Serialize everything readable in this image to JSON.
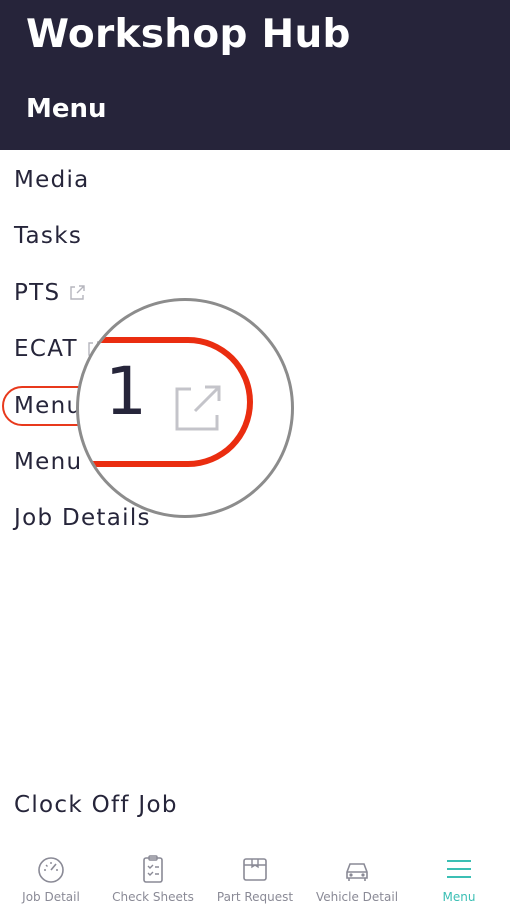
{
  "header": {
    "app_title": "Workshop Hub",
    "section_title": "Menu"
  },
  "menu": {
    "items": [
      {
        "label": "Media",
        "external": false
      },
      {
        "label": "Tasks",
        "external": false
      },
      {
        "label": "PTS",
        "external": true
      },
      {
        "label": "ECAT",
        "external": true
      },
      {
        "label": "Menu",
        "external": false
      },
      {
        "label": "Menu",
        "external": false
      },
      {
        "label": "Job Details",
        "external": false
      }
    ],
    "clock_off": "Clock Off Job"
  },
  "magnifier": {
    "text": "1",
    "icon": "external-link-icon"
  },
  "bottom_nav": {
    "items": [
      {
        "label": "Job Detail",
        "icon": "speedometer-icon",
        "active": false
      },
      {
        "label": "Check Sheets",
        "icon": "clipboard-icon",
        "active": false
      },
      {
        "label": "Part Request",
        "icon": "box-icon",
        "active": false
      },
      {
        "label": "Vehicle Detail",
        "icon": "car-icon",
        "active": false
      },
      {
        "label": "Menu",
        "icon": "hamburger-icon",
        "active": true
      }
    ]
  },
  "colors": {
    "header_bg": "#26243a",
    "accent": "#3bbfb4",
    "highlight": "#e8391c",
    "text": "#26253a"
  }
}
